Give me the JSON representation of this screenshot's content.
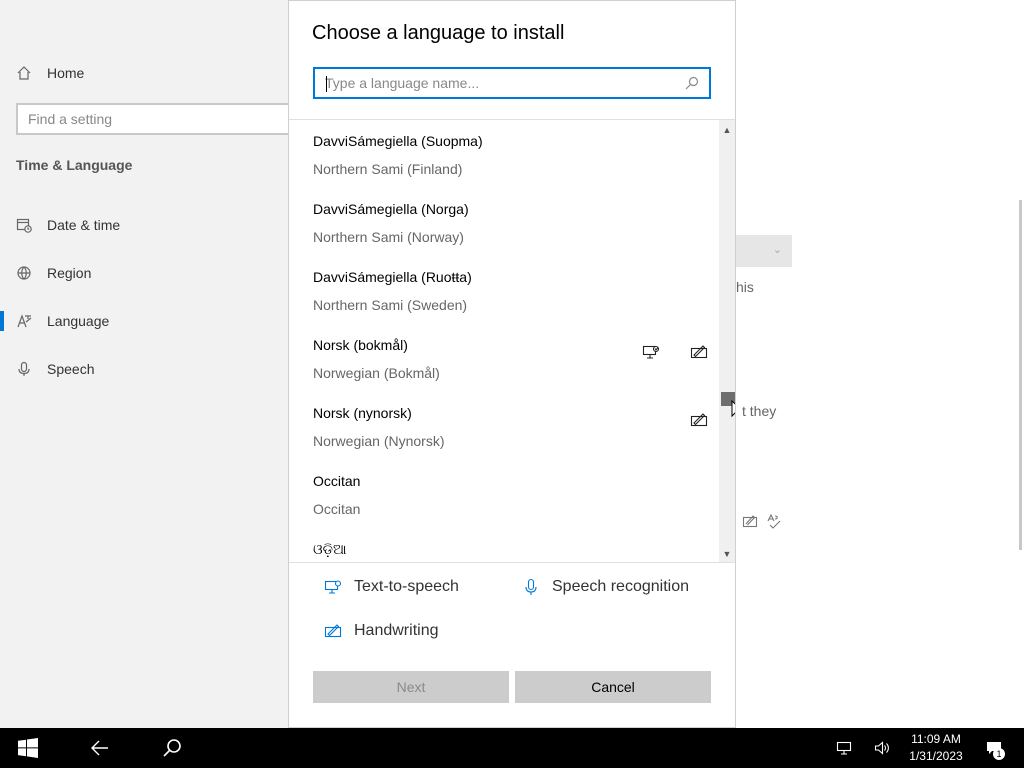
{
  "settings_nav": {
    "home_label": "Home",
    "search_placeholder": "Find a setting",
    "section_title": "Time & Language",
    "items": [
      {
        "label": "Date & time",
        "icon": "calendar-clock-icon"
      },
      {
        "label": "Region",
        "icon": "globe-icon"
      },
      {
        "label": "Language",
        "icon": "language-icon",
        "selected": true
      },
      {
        "label": "Speech",
        "icon": "microphone-icon"
      }
    ]
  },
  "background_text": {
    "fragment_1": "his",
    "fragment_2": "t they"
  },
  "dialog": {
    "title": "Choose a language to install",
    "search_placeholder": "Type a language name...",
    "languages": [
      {
        "native": "DavviSámegiella (Suopma)",
        "english": "Northern Sami (Finland)",
        "features": []
      },
      {
        "native": "DavviSámegiella (Norga)",
        "english": "Northern Sami (Norway)",
        "features": []
      },
      {
        "native": "DavviSámegiella (Ruoŧŧa)",
        "english": "Northern Sami (Sweden)",
        "features": []
      },
      {
        "native": "Norsk (bokmål)",
        "english": "Norwegian (Bokmål)",
        "features": [
          "text-to-speech",
          "handwriting"
        ]
      },
      {
        "native": "Norsk (nynorsk)",
        "english": "Norwegian (Nynorsk)",
        "features": [
          "handwriting"
        ]
      },
      {
        "native": "Occitan",
        "english": "Occitan",
        "features": []
      },
      {
        "native": "ଓଡ଼ିଆ",
        "english": "",
        "features": []
      }
    ],
    "legend": {
      "text_to_speech": "Text-to-speech",
      "speech_recognition": "Speech recognition",
      "handwriting": "Handwriting"
    },
    "next_label": "Next",
    "cancel_label": "Cancel"
  },
  "taskbar": {
    "time": "11:09 AM",
    "date": "1/31/2023",
    "notification_count": "1"
  },
  "colors": {
    "accent": "#0078d7",
    "taskbar": "#000000",
    "button": "#cccccc"
  }
}
